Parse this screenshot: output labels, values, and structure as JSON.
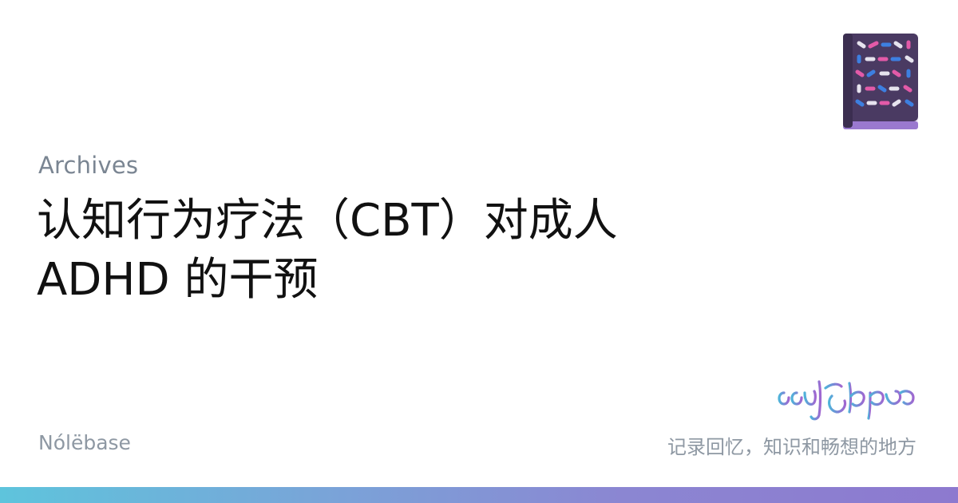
{
  "header": {
    "category": "Archives",
    "title": "认知行为疗法（CBT）对成人 ADHD 的干预"
  },
  "footer": {
    "site_name": "Nólëbase",
    "tagline": "记录回忆，知识和畅想的地方"
  },
  "icons": {
    "book": "book-icon",
    "logo": "tengwar-script-logo"
  },
  "colors": {
    "title": "#111111",
    "muted": "#7a8592",
    "gradient_start": "#5ec4dc",
    "gradient_end": "#8d79cf",
    "book_cover": "#4a3a62"
  }
}
